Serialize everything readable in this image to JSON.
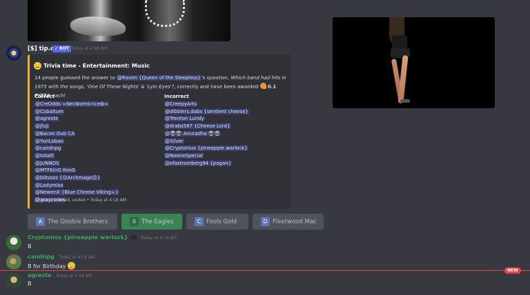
{
  "bot": {
    "name": "[$] tip.cc",
    "badge": "✓ BOT",
    "timestamp": "Today at 4:18 AM"
  },
  "embed": {
    "title": "Trivia time - Entertainment: Music",
    "desc_prefix": "14 people guessed the answer to ",
    "mention": "@Raven {Queen of the Sleepless}",
    "desc_mid": "'s question, ",
    "question": "Which band had hits in 1975 with the songs, 'One Of These Nights' & 'Lyin Eyes'?",
    "desc_suffix": ", correctly and have been awarded ",
    "award": "0.1 PIZZA",
    "award_tail": " each!",
    "correct_title": "Correct",
    "incorrect_title": "Incorrect",
    "correct": [
      "@CreOdds ∞Nec⊞omś∩ice⊞∞",
      "@Cobaltum",
      "@agreste",
      "@jfuji",
      "@Bacon Dub CA",
      "@YuriLobao",
      "@candnpg",
      "@tolatli",
      "@JUNNOS",
      "@MTFKinG KonG",
      "@blitzzzz {☺Archmage☺}",
      "@Ladymisa",
      "@NewenX {Blue Cheese Viking⚔}",
      "@grayzones"
    ],
    "incorrect": [
      "@CreepyArts",
      "@dibblers.dabs {sentient cheese}",
      "@Trenton Lundy",
      "@drabs587 {Cheese Lord}",
      "@👽👽 Anuradha 👽👽",
      "@Silver",
      "@Cryptonius {pineapple warlock}",
      "@NooneSpecial",
      "@efastromberg94 {pagan}"
    ],
    "footer_count": "23 users entered, ended",
    "footer_sep": "•",
    "footer_time": "Today at 4:18 AM",
    "accent": "#f0b232"
  },
  "answers": [
    {
      "letter": "A",
      "label": "The Doobie Brothers"
    },
    {
      "letter": "B",
      "label": "The Eagles"
    },
    {
      "letter": "C",
      "label": "Fools Gold"
    },
    {
      "letter": "D",
      "label": "Fleetwood Mac"
    }
  ],
  "messages": [
    {
      "user": "Cryptonius {pineapple warlock}",
      "time": "Today at 4:18 AM",
      "text": "B",
      "color": "#3ba55d"
    },
    {
      "user": "candnpg",
      "time": "Today at 4:18 AM",
      "text": "B for Birthday",
      "color": "#3ba55d"
    },
    {
      "user": "agreste",
      "time": "Today at 4:18 AM",
      "text": "B",
      "color": "#3ba55d"
    }
  ],
  "new_badge": "NEW"
}
